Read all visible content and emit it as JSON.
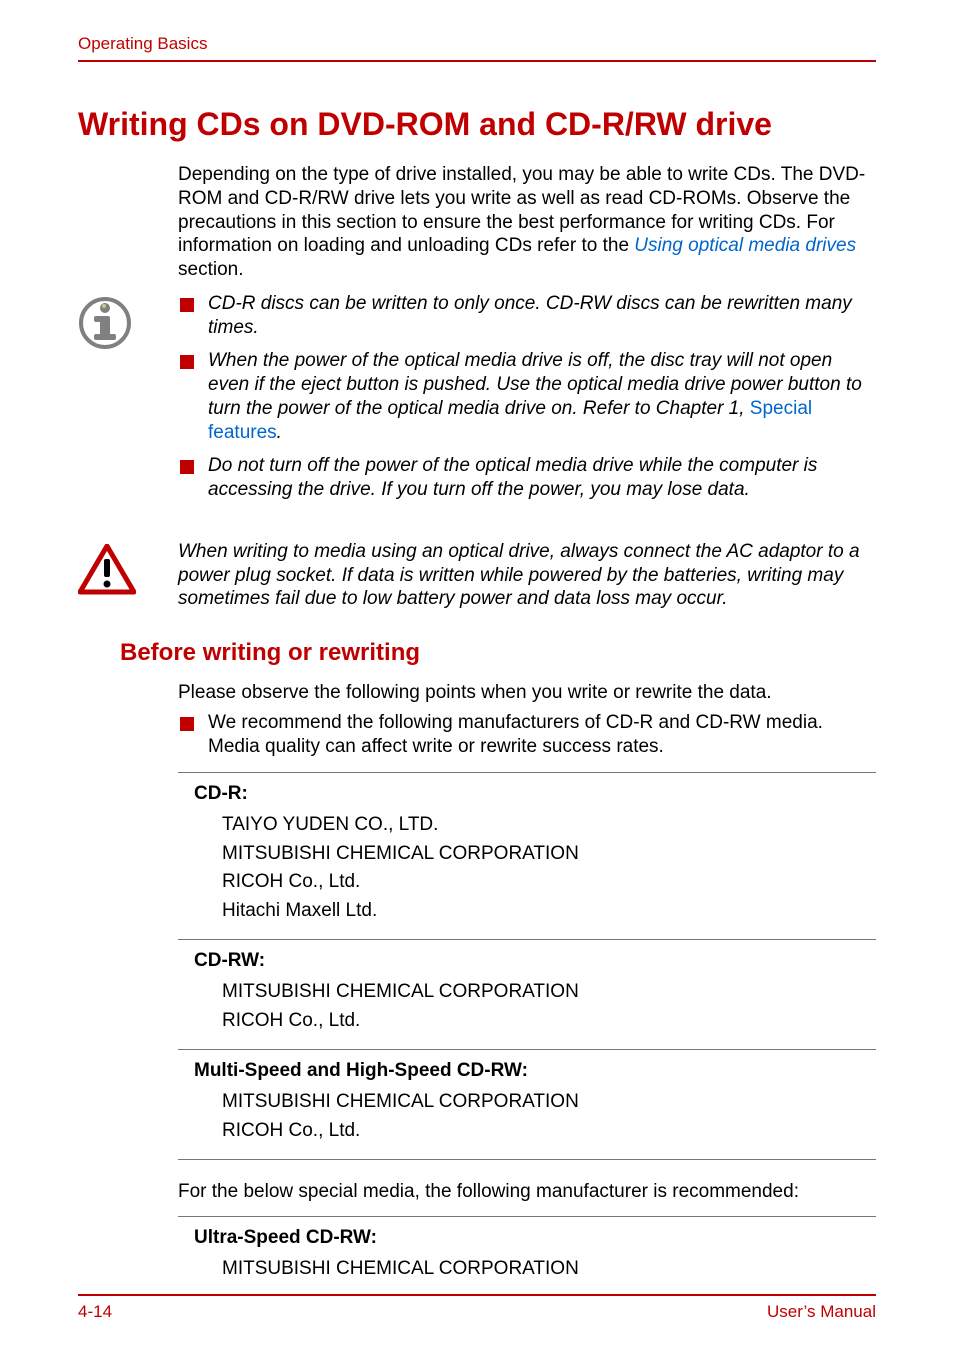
{
  "running_head": "Operating Basics",
  "h1": "Writing CDs on DVD-ROM and CD-R/RW drive",
  "intro_pre": "Depending on the type of drive installed, you may be able to write CDs. The DVD-ROM and CD-R/RW drive lets you write as well as read CD-ROMs. Observe the precautions in this section to ensure the best performance for writing CDs. For information on loading and unloading CDs refer to the ",
  "intro_link": "Using optical media drives",
  "intro_post": " section.",
  "info_bullets": {
    "b1": "CD-R discs can be written to only once. CD-RW discs can be rewritten many times.",
    "b2_pre": "When the power of the optical media drive is off, the disc tray will not open even if the eject button is pushed. Use the optical media drive power button to turn the power of the optical media drive on. Refer to Chapter 1, ",
    "b2_link": "Special features",
    "b2_post": ".",
    "b3": "Do not turn off the power of the optical media drive while the computer is accessing the drive. If you turn off the power, you may lose data."
  },
  "caution_text": "When writing to media using an optical drive, always connect the AC adaptor to a power plug socket. If data is written while powered by the batteries, writing may sometimes fail due to low battery power and data loss may occur.",
  "h2": "Before writing or rewriting",
  "before_intro": "Please observe the following points when you write or rewrite the data.",
  "before_bullet": "We recommend the following manufacturers of CD-R and CD-RW media. Media quality can affect write or rewrite success rates.",
  "media": {
    "cdr": {
      "title": "CD-R:",
      "i1": "TAIYO YUDEN CO., LTD.",
      "i2": "MITSUBISHI CHEMICAL CORPORATION",
      "i3": "RICOH Co., Ltd.",
      "i4": "Hitachi Maxell Ltd."
    },
    "cdrw": {
      "title": "CD-RW:",
      "i1": "MITSUBISHI CHEMICAL CORPORATION",
      "i2": "RICOH Co., Ltd."
    },
    "mshs": {
      "title": "Multi-Speed and High-Speed CD-RW:",
      "i1": "MITSUBISHI CHEMICAL CORPORATION",
      "i2": "RICOH Co., Ltd."
    },
    "ultra": {
      "title": "Ultra-Speed CD-RW:",
      "i1": "MITSUBISHI CHEMICAL CORPORATION"
    }
  },
  "special_note": "For the below special media, the following manufacturer is recommended:",
  "footer_left": "4-14",
  "footer_right": "User’s Manual"
}
